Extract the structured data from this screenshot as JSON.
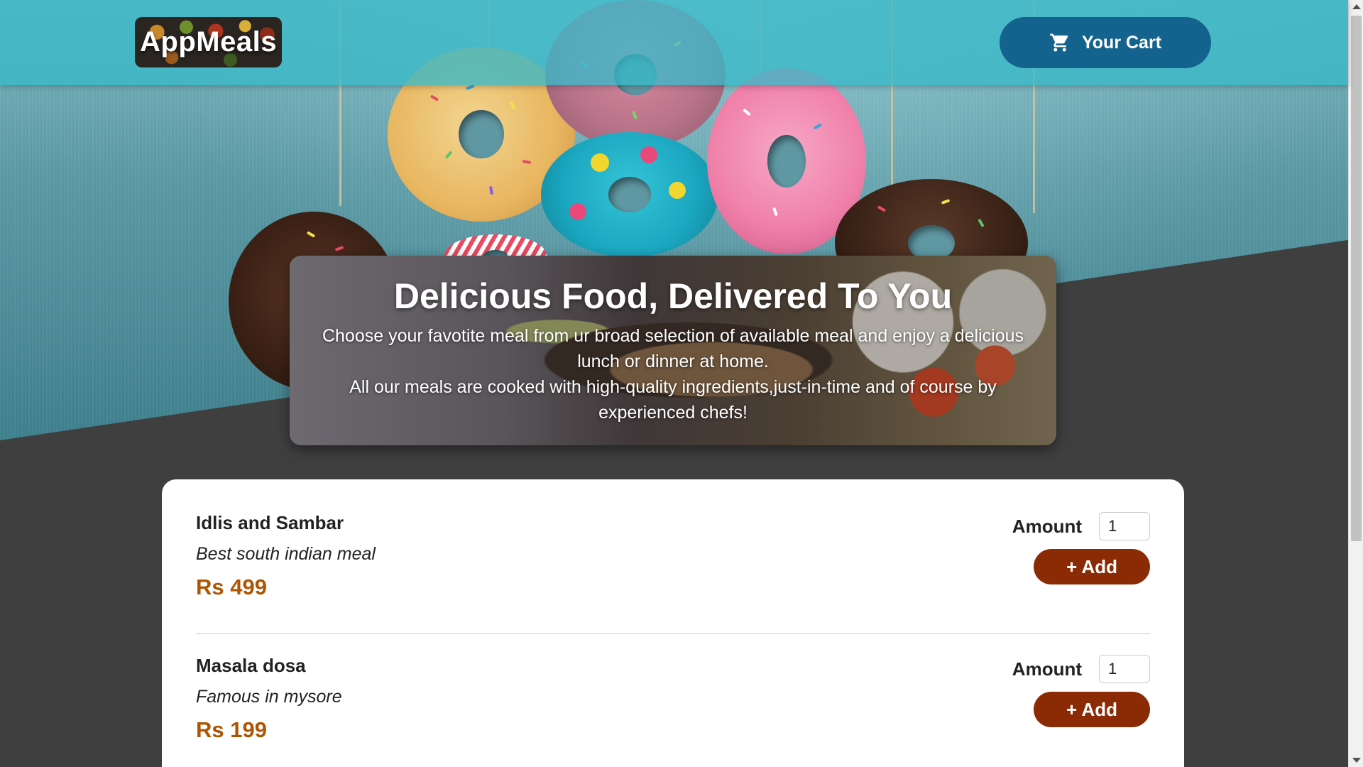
{
  "header": {
    "logo_text": "AppMeals",
    "cart_label": "Your Cart",
    "cart_icon": "shopping-cart-icon"
  },
  "summary": {
    "title": "Delicious Food, Delivered To You",
    "paragraph1": "Choose your favotite meal from ur broad selection of available meal and enjoy a delicious lunch or dinner at home.",
    "paragraph2": "All our meals are cooked with high-quality ingredients,just-in-time and of course by experienced chefs!"
  },
  "meals": [
    {
      "name": "Idlis and Sambar",
      "description": "Best south indian meal",
      "price": "Rs 499",
      "amount_label": "Amount",
      "amount_value": "1",
      "add_label": "+ Add"
    },
    {
      "name": "Masala dosa",
      "description": "Famous in mysore",
      "price": "Rs 199",
      "amount_label": "Amount",
      "amount_value": "1",
      "add_label": "+ Add"
    }
  ],
  "colors": {
    "header": "#39b8c8",
    "cart_button": "#14628e",
    "add_button": "#8a2b06",
    "price": "#ad5502",
    "page_background": "#3f3f3f"
  }
}
